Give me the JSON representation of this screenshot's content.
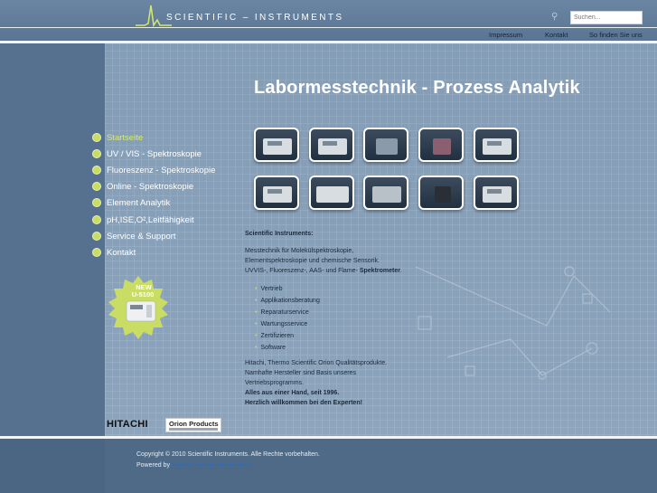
{
  "header": {
    "logo_text": "SCIENTIFIC – INSTRUMENTS",
    "search_placeholder": "Suchen...",
    "search_icon": "search-icon",
    "top_nav": [
      "Impressum",
      "Kontakt",
      "So finden Sie uns"
    ]
  },
  "main": {
    "title": "Labormesstechnik - Prozess Analytik",
    "nav": [
      {
        "label": "Startseite",
        "active": true
      },
      {
        "label": "UV / VIS - Spektroskopie"
      },
      {
        "label": "Fluoreszenz - Spektroskopie"
      },
      {
        "label": "Online - Spektroskopie"
      },
      {
        "label": "Element Analytik"
      },
      {
        "label": "pH,ISE,O²,Leitfähigkeit"
      },
      {
        "label": "Service & Support"
      },
      {
        "label": "Kontakt"
      }
    ],
    "badge": {
      "line1": "NEW",
      "line2": "U-5100"
    },
    "intro_heading": "Scientific Instruments:",
    "intro_lines": [
      "Messtechnik für Molekülspektroskopie,",
      "Elementspektroskopie und chemische Sensorik.",
      "UVVIS-, Fluoreszenz-, AAS- und Flame-"
    ],
    "intro_bold_end": "Spektrometer",
    "intro_period": ".",
    "services": [
      "Vertrieb",
      "Applikationsberatung",
      "Reparaturservice",
      "Wartungsservice",
      "Zertifizieren",
      "Software"
    ],
    "closing_lines": [
      "Hitachi, Thermo Scientific Orion Qualitätsprodukte.",
      "Namhafte Hersteller sind Basis unseres",
      "Vertriebsprogramms."
    ],
    "closing_bold": [
      "Alles aus einer Hand, seit 1996.",
      "Herzlich willkommen bei den Experten!"
    ],
    "partner_logos": {
      "hitachi": "HITACHI",
      "orion": "Orion Products"
    }
  },
  "footer": {
    "copyright": "Copyright © 2010 Scientific Instruments. Alle Rechte vorbehalten.",
    "powered_by": "Powered by",
    "powered_links": [
      "••••••••",
      "•••••••••••••••••••••••••••"
    ]
  },
  "colors": {
    "accent_green": "#c9dc63",
    "link_blue": "#1f6fd6"
  }
}
